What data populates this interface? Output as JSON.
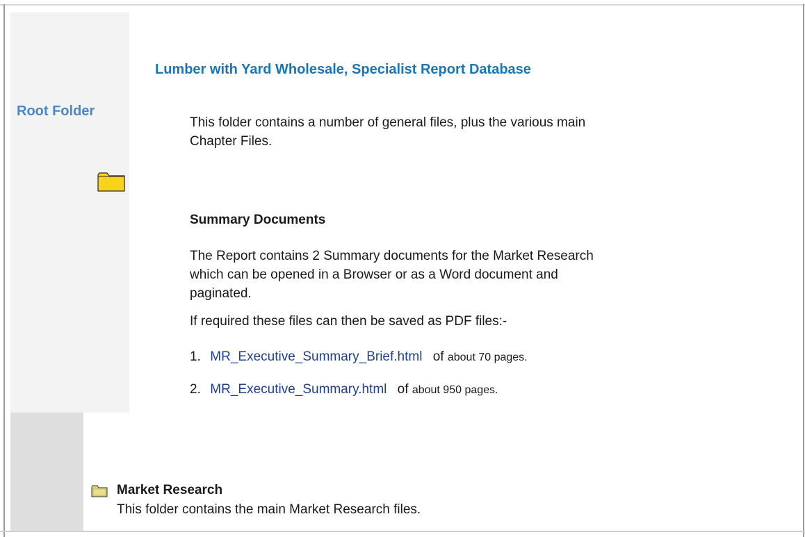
{
  "sidebar": {
    "label": "Root Folder",
    "folder_icon": "folder-icon",
    "accent_color": "#4a86c8"
  },
  "header": {
    "title": "Lumber with Yard Wholesale, Specialist Report Database",
    "title_color": "#1a74b8"
  },
  "intro": {
    "text": "This folder contains a number of general files, plus the various main Chapter Files."
  },
  "summary": {
    "heading": "Summary Documents",
    "text": "The Report contains 2 Summary documents for the Market Research which can be opened in a Browser or as a Word document and paginated.",
    "pdf_text": "If required these files can then be saved as PDF files:-",
    "files": [
      {
        "num": "1.",
        "name": "MR_Executive_Summary_Brief.html",
        "of": "of",
        "size": "about 70 pages."
      },
      {
        "num": "2.",
        "name": "MR_Executive_Summary.html",
        "of": "of",
        "size": "about 950 pages."
      }
    ],
    "link_color": "#1f3f8f"
  },
  "market_research": {
    "heading": "Market Research",
    "text": "This folder contains the main Market Research files.",
    "icon": "folder-icon"
  }
}
